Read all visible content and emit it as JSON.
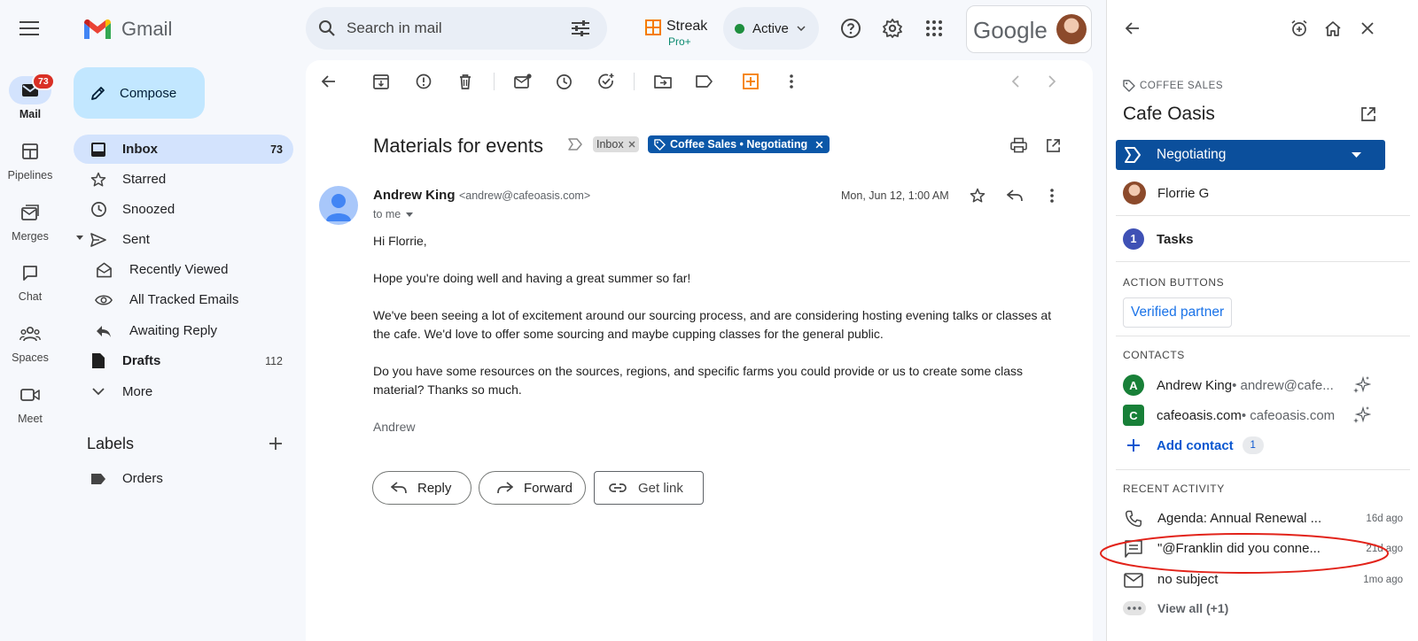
{
  "rail": {
    "unread_badge": "73",
    "items": [
      {
        "label": "Mail",
        "icon": "mail-icon"
      },
      {
        "label": "Pipelines",
        "icon": "pipelines-icon"
      },
      {
        "label": "Merges",
        "icon": "merges-icon"
      },
      {
        "label": "Chat",
        "icon": "chat-icon"
      },
      {
        "label": "Spaces",
        "icon": "spaces-icon"
      },
      {
        "label": "Meet",
        "icon": "meet-icon"
      }
    ]
  },
  "header": {
    "app_name": "Gmail",
    "search_placeholder": "Search in mail",
    "streak_label": "Streak",
    "streak_plan": "Pro+",
    "status": "Active",
    "google_label": "Google"
  },
  "nav": {
    "compose_label": "Compose",
    "items": [
      {
        "label": "Inbox",
        "count": "73"
      },
      {
        "label": "Starred",
        "count": ""
      },
      {
        "label": "Snoozed",
        "count": ""
      },
      {
        "label": "Sent",
        "count": ""
      },
      {
        "label": "Recently Viewed",
        "count": ""
      },
      {
        "label": "All Tracked Emails",
        "count": ""
      },
      {
        "label": "Awaiting Reply",
        "count": ""
      },
      {
        "label": "Drafts",
        "count": "112"
      },
      {
        "label": "More",
        "count": ""
      }
    ],
    "labels_heading": "Labels",
    "labels": [
      {
        "label": "Orders"
      }
    ]
  },
  "email": {
    "subject": "Materials for events",
    "inbox_chip": "Inbox",
    "pipeline_chip": "Coffee Sales • Negotiating",
    "sender_name": "Andrew King",
    "sender_email": "<andrew@cafeoasis.com>",
    "to_line": "to me",
    "date": "Mon, Jun 12, 1:00 AM",
    "greeting": "Hi Florrie,",
    "para1": "Hope you're doing well and having a great summer so far!",
    "para2": "We've been seeing a lot of excitement around our sourcing process, and are considering hosting evening talks or classes at the cafe. We'd love to offer some sourcing and maybe cupping classes for the general public.",
    "para3": "Do you have some resources on the sources, regions, and specific farms you could provide or us to create some class material? Thanks so much.",
    "signature": "Andrew",
    "reply_label": "Reply",
    "forward_label": "Forward",
    "getlink_label": "Get link"
  },
  "panel": {
    "pipeline_name": "COFFEE SALES",
    "box_name": "Cafe Oasis",
    "stage": "Negotiating",
    "assignee": "Florrie G",
    "tasks_count": "1",
    "tasks_label": "Tasks",
    "action_buttons_heading": "ACTION BUTTONS",
    "verified_button": "Verified partner",
    "contacts_heading": "CONTACTS",
    "contacts": [
      {
        "initial": "A",
        "name": "Andrew King",
        "detail": " • andrew@cafe...",
        "color": "#188038"
      },
      {
        "initial": "C",
        "name": "cafeoasis.com",
        "detail": " • cafeoasis.com",
        "color": "#188038"
      }
    ],
    "add_contact_label": "Add contact",
    "add_contact_count": "1",
    "recent_heading": "RECENT ACTIVITY",
    "activity": [
      {
        "icon": "phone-icon",
        "text": "Agenda: Annual Renewal ...",
        "time": "16d ago"
      },
      {
        "icon": "comment-icon",
        "text": "\"@Franklin did you conne...",
        "time": "21d ago"
      },
      {
        "icon": "mail-icon",
        "text": "no subject",
        "time": "1mo ago"
      }
    ],
    "view_all_label": "View all (+1)"
  },
  "colors": {
    "accent_blue": "#0b57d0",
    "streak_stage": "#0b4f9c",
    "highlight_circle": "#e2231a"
  }
}
